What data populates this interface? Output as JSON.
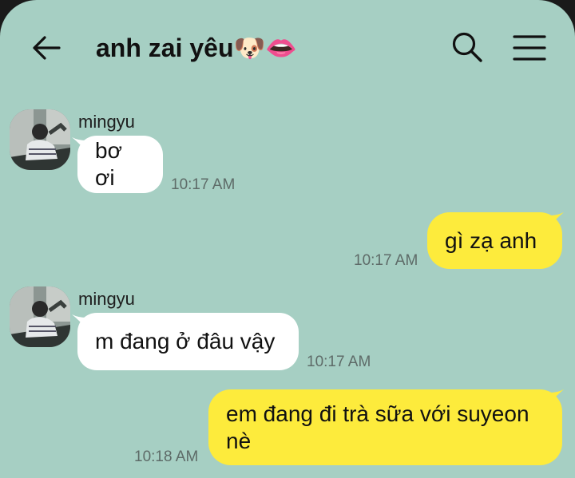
{
  "header": {
    "title": "anh zai yêu🐶👄",
    "back_icon": "arrow-left-icon",
    "search_icon": "search-icon",
    "menu_icon": "hamburger-menu-icon"
  },
  "colors": {
    "background": "#a6cfc3",
    "incoming_bubble": "#ffffff",
    "outgoing_bubble": "#fdeb3c"
  },
  "messages": [
    {
      "direction": "incoming",
      "sender": "mingyu",
      "text": "bơ ơi",
      "time": "10:17 AM"
    },
    {
      "direction": "outgoing",
      "text": "gì zạ anh",
      "time": "10:17 AM"
    },
    {
      "direction": "incoming",
      "sender": "mingyu",
      "text": "m đang ở đâu vậy",
      "time": "10:17 AM"
    },
    {
      "direction": "outgoing",
      "text": "em đang đi trà sữa với suyeon nè",
      "time": "10:18 AM"
    }
  ]
}
